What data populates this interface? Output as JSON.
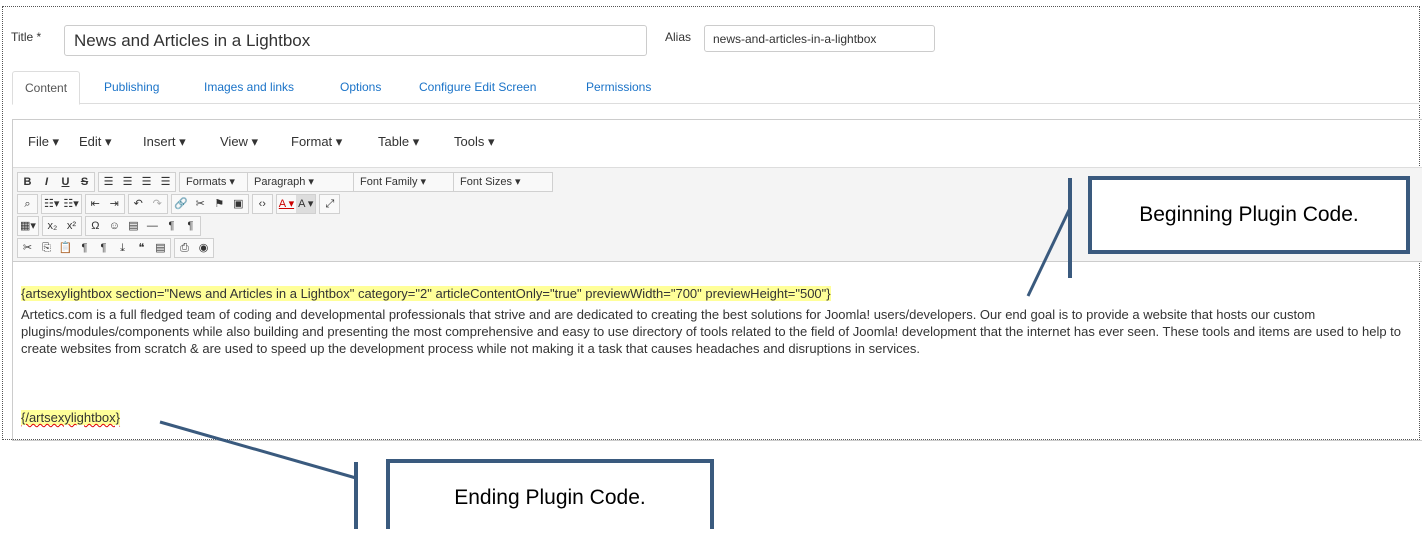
{
  "form": {
    "title_label": "Title *",
    "title_value": "News and Articles in a Lightbox",
    "alias_label": "Alias",
    "alias_value": "news-and-articles-in-a-lightbox"
  },
  "tabs": [
    {
      "label": "Content",
      "active": true
    },
    {
      "label": "Publishing"
    },
    {
      "label": "Images and links"
    },
    {
      "label": "Options"
    },
    {
      "label": "Configure Edit Screen"
    },
    {
      "label": "Permissions"
    }
  ],
  "menubar": [
    "File ▾",
    "Edit ▾",
    "Insert ▾",
    "View ▾",
    "Format ▾",
    "Table ▾",
    "Tools ▾"
  ],
  "toolbar": {
    "formats": "Formats ▾",
    "paragraph": "Paragraph",
    "font_family": "Font Family",
    "font_sizes": "Font Sizes"
  },
  "content": {
    "open_tag": "{artsexylightbox section=\"News and Articles in a Lightbox\" category=\"2\" articleContentOnly=\"true\" previewWidth=\"700\" previewHeight=\"500\"}",
    "body": "Artetics.com is a full fledged team of coding and developmental professionals that strive and are dedicated to creating the best solutions for Joomla! users/developers. Our end goal is to provide a website that hosts our custom plugins/modules/components while also building and presenting the most comprehensive and easy to use directory of tools related to the field of Joomla! development that the internet has ever seen. These tools and items are used to help to create websites from scratch & are used to speed up the development process while not making it a task that causes headaches and disruptions in services.",
    "close_tag": "{/artsexylightbox}"
  },
  "callouts": {
    "begin": "Beginning Plugin Code.",
    "end": "Ending Plugin Code."
  },
  "colors": {
    "callout_border": "#3a5a7e",
    "highlight": "#ffff99",
    "link": "#1a73c8"
  }
}
